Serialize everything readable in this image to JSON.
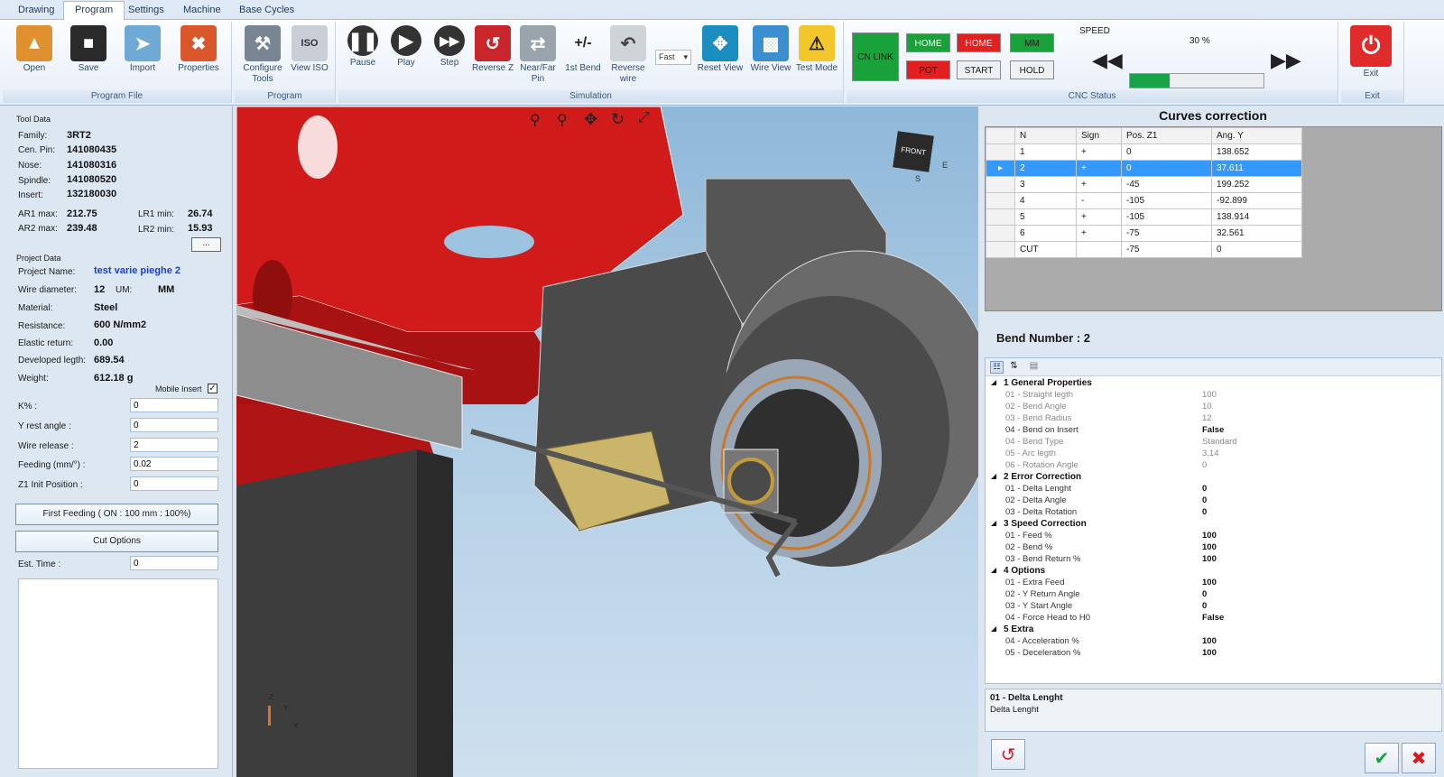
{
  "tabs": [
    "Drawing",
    "Program",
    "Settings",
    "Machine",
    "Base Cycles"
  ],
  "ribbon": {
    "program_file": {
      "title": "Program File",
      "buttons": [
        "Open",
        "Save",
        "Import",
        "Properties"
      ]
    },
    "program": {
      "title": "Program",
      "configure": "Configure Tools",
      "view_iso": "View ISO"
    },
    "simulation": {
      "title": "Simulation",
      "pause": "Pause",
      "play": "Play",
      "step": "Step",
      "reverse_z": "Reverse Z",
      "near_far": "Near/Far Pin",
      "first_bend": "1st Bend",
      "reverse_wire": "Reverse wire",
      "speed_select": "Fast",
      "reset_view": "Reset View",
      "wire_view": "Wire View",
      "test_mode": "Test Mode"
    },
    "cnc": {
      "title": "CNC Status",
      "cn_link": "CN LINK",
      "home1": "HOME",
      "home2": "HOME",
      "mm": "MM",
      "pot": "POT",
      "start": "START",
      "hold": "HOLD",
      "speed_label": "SPEED",
      "speed_value": "30 %",
      "speed_fraction": 0.3
    },
    "exit": {
      "title": "Exit",
      "label": "Exit"
    }
  },
  "tool_data": {
    "title": "Tool Data",
    "family_l": "Family:",
    "family": "3RT2",
    "cen_l": "Cen. Pin:",
    "cen": "141080435",
    "nose_l": "Nose:",
    "nose": "141080316",
    "spindle_l": "Spindle:",
    "spindle": "141080520",
    "insert_l": "Insert:",
    "insert": "132180030",
    "ar1_l": "AR1 max:",
    "ar1": "212.75",
    "lr1_l": "LR1 min:",
    "lr1": "26.74",
    "ar2_l": "AR2 max:",
    "ar2": "239.48",
    "lr2_l": "LR2 min:",
    "lr2": "15.93",
    "more": "..."
  },
  "project": {
    "title": "Project Data",
    "name_l": "Project Name:",
    "name": "test varie pieghe 2",
    "wire_l": "Wire diameter:",
    "wire": "12",
    "um_l": "UM:",
    "um": "MM",
    "mat_l": "Material:",
    "mat": "Steel",
    "res_l": "Resistance:",
    "res": "600 N/mm2",
    "elastic_l": "Elastic return:",
    "elastic": "0.00",
    "dev_l": "Developed legth:",
    "dev": "689.54",
    "weight_l": "Weight:",
    "weight": "612.18 g",
    "mobile_l": "Mobile Insert",
    "k_l": "K% :",
    "k": "0",
    "yrest_l": "Y rest angle :",
    "yrest": "0",
    "wrel_l": "Wire release :",
    "wrel": "2",
    "feed_l": "Feeding (mm/°) :",
    "feed": "0.02",
    "z1_l": "Z1 Init Position :",
    "z1": "0",
    "first_feed": "First Feeding  ( ON  : 100 mm  : 100%)",
    "cut": "Cut Options",
    "est_l": "Est. Time :",
    "est": "0"
  },
  "curves": {
    "title": "Curves correction",
    "headers": [
      "N",
      "Sign",
      "Pos. Z1",
      "Ang. Y"
    ],
    "rows": [
      [
        "1",
        "+",
        "0",
        "138.652"
      ],
      [
        "2",
        "+",
        "0",
        "37.611"
      ],
      [
        "3",
        "+",
        "-45",
        "199.252"
      ],
      [
        "4",
        "-",
        "-105",
        "-92.899"
      ],
      [
        "5",
        "+",
        "-105",
        "138.914"
      ],
      [
        "6",
        "+",
        "-75",
        "32.561"
      ],
      [
        "CUT",
        "",
        "-75",
        "0"
      ]
    ]
  },
  "bend": {
    "label": "Bend Number : 2"
  },
  "props": [
    {
      "cat": "1 General Properties",
      "items": [
        [
          "01 - Straight legth",
          "100"
        ],
        [
          "02 - Bend Angle",
          "10"
        ],
        [
          "03 - Bend Radius",
          "12"
        ],
        [
          "04 - Bend on Insert",
          "False"
        ],
        [
          "04 - Bend Type",
          "Standard"
        ],
        [
          "05 - Arc legth",
          "3.14"
        ],
        [
          "06 - Rotation Angle",
          "0"
        ]
      ]
    },
    {
      "cat": "2 Error Correction",
      "items": [
        [
          "01 - Delta Lenght",
          "0"
        ],
        [
          "02 - Delta Angle",
          "0"
        ],
        [
          "03 - Delta Rotation",
          "0"
        ]
      ]
    },
    {
      "cat": "3 Speed Correction",
      "items": [
        [
          "01 - Feed %",
          "100"
        ],
        [
          "02 - Bend %",
          "100"
        ],
        [
          "03 - Bend Return %",
          "100"
        ]
      ]
    },
    {
      "cat": "4 Options",
      "items": [
        [
          "01 - Extra Feed",
          "100"
        ],
        [
          "02 - Y Return Angle",
          "0"
        ],
        [
          "03 - Y Start Angle",
          "0"
        ],
        [
          "04 - Force Head to H0",
          "False"
        ]
      ]
    },
    {
      "cat": "5 Extra",
      "items": [
        [
          "04 - Acceleration %",
          "100"
        ],
        [
          "05 - Deceleration %",
          "100"
        ]
      ]
    }
  ],
  "desc": {
    "title": "01 - Delta Lenght",
    "text": "Delta Lenght"
  },
  "viewcube": {
    "face": "FRONT",
    "south": "S",
    "east": "E"
  },
  "axes": {
    "z": "Z",
    "y": "Y",
    "x": "X"
  },
  "colors": {
    "selected_row": "#3399ff",
    "cnc_green": "#19a13a",
    "cnc_red": "#e32020",
    "frame_red": "#d11a1a"
  }
}
